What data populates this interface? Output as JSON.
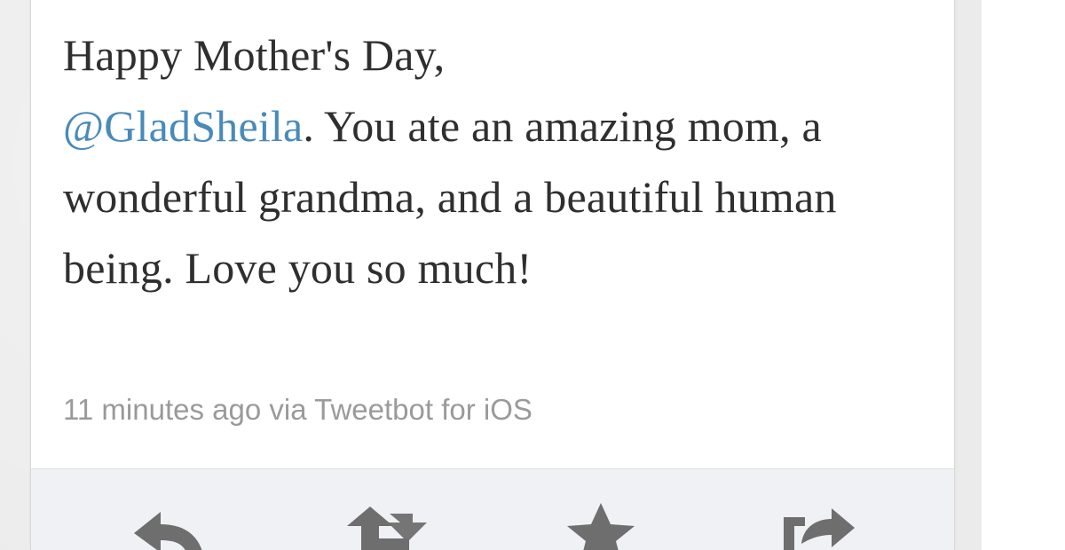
{
  "tweet": {
    "text_before": "Happy Mother's Day,",
    "mention": "@GladSheila",
    "text_after": ". You ate an amazing mom, a wonderful grandma, and a beautiful human being. Love you so much!",
    "meta": "11 minutes ago via Tweetbot for iOS"
  },
  "actions": {
    "icons": [
      "reply-icon",
      "retweet-icon",
      "favorite-icon",
      "share-icon"
    ]
  },
  "colors": {
    "text": "#2f2f2f",
    "mention": "#4a8ab9",
    "meta": "#9a9a9a",
    "action_bar_bg": "#eff1f5",
    "icon": "#6e6e6e",
    "page_bg": "#ebebeb"
  }
}
